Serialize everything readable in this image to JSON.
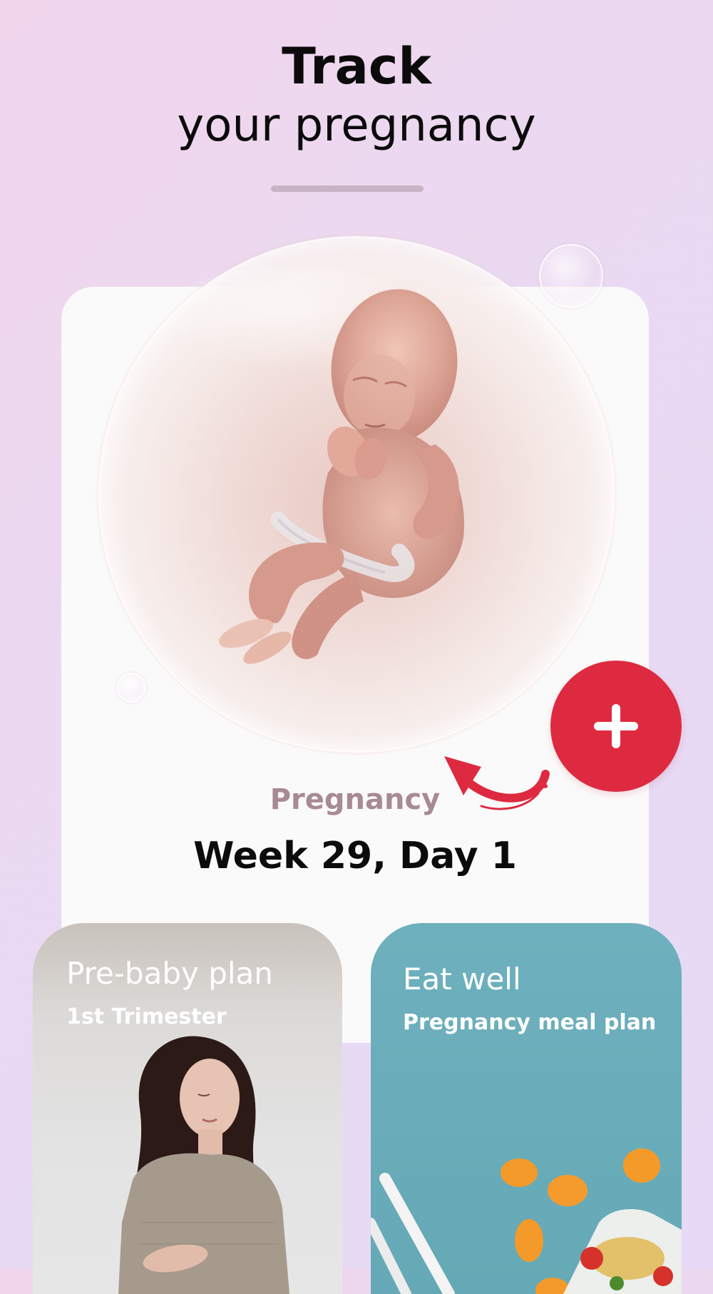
{
  "header": {
    "title_bold": "Track",
    "title_light": "your pregnancy"
  },
  "status": {
    "label": "Pregnancy",
    "value": "Week 29, Day 1"
  },
  "add_button": {
    "icon": "plus-icon"
  },
  "cards": [
    {
      "title": "Pre-baby plan",
      "subtitle": "1st Trimester",
      "image": "pregnant-woman-photo"
    },
    {
      "title": "Eat well",
      "subtitle": "Pregnancy meal plan",
      "image": "meal-prep-photo"
    }
  ],
  "colors": {
    "accent": "#de2a40",
    "status_label": "#a88a93",
    "eat_card": "#66a9b6"
  }
}
